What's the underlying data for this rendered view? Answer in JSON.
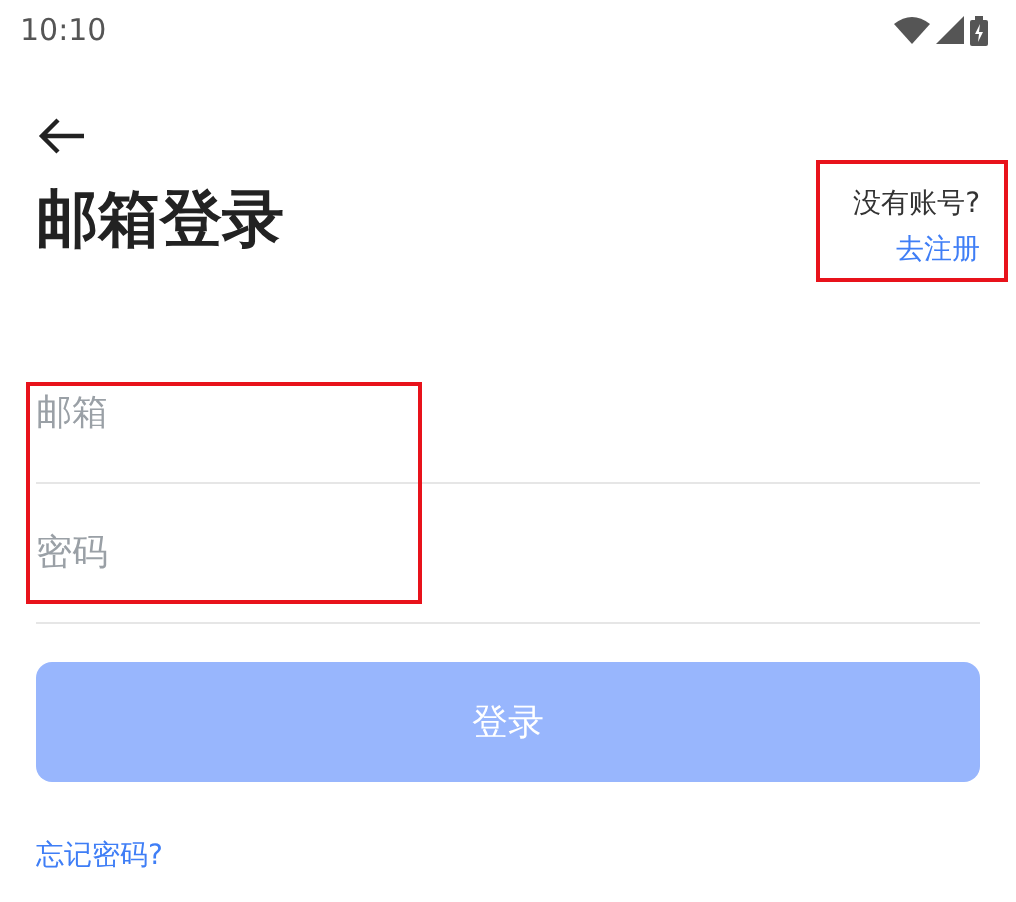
{
  "status_bar": {
    "time": "10:10"
  },
  "title": "邮箱登录",
  "register": {
    "prompt": "没有账号?",
    "link": "去注册"
  },
  "fields": [
    {
      "placeholder": "邮箱"
    },
    {
      "placeholder": "密码"
    }
  ],
  "login_button": {
    "label": "登录",
    "disabled": true
  },
  "forgot_link": "忘记密码?"
}
